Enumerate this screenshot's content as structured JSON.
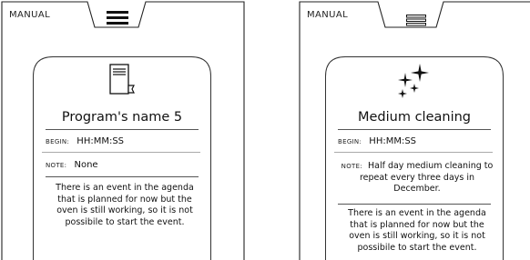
{
  "screens": [
    {
      "mode_label": "MANUAL",
      "menu_icon": "hamburger-menu-icon",
      "card_icon": "program-book-icon",
      "title": "Program's name 5",
      "begin_key": "BEGIN:",
      "begin_value": "HH:MM:SS",
      "note_key": "NOTE:",
      "note_value": "None",
      "info_text": "There is an event in the agenda that is planned for now but the oven is still working, so it is not possibile to start the event."
    },
    {
      "mode_label": "MANUAL",
      "menu_icon": "hamburger-menu-icon",
      "card_icon": "sparkles-icon",
      "title": "Medium cleaning",
      "begin_key": "BEGIN:",
      "begin_value": "HH:MM:SS",
      "note_key": "NOTE:",
      "note_value": "Half day medium cleaning to repeat every three days in December.",
      "info_text": "There is an event in the agenda that is planned for now but the oven is still working, so it is not possibile to start the event."
    }
  ]
}
